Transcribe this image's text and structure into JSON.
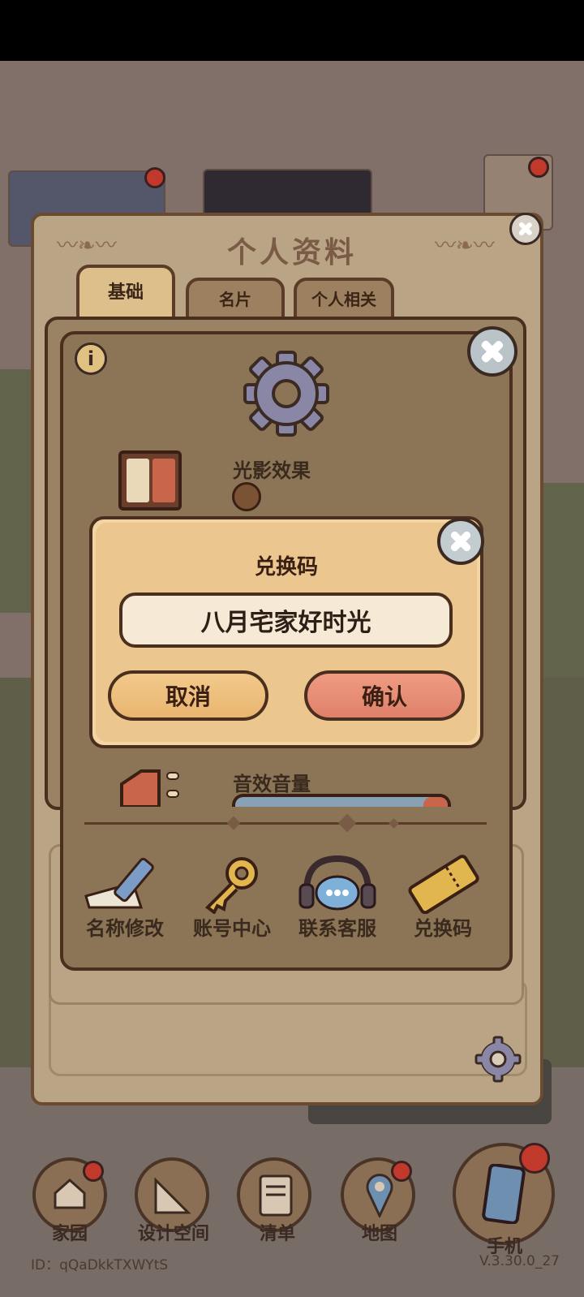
{
  "panel": {
    "title": "个人资料",
    "tabs": [
      {
        "label": "基础",
        "active": true
      },
      {
        "label": "名片",
        "active": false
      },
      {
        "label": "个人相关",
        "active": false
      }
    ]
  },
  "settings": {
    "rows": {
      "light_effect_label": "光影效果",
      "sound_volume_label": "音效音量"
    },
    "actions": [
      {
        "label": "名称修改",
        "icon": "pencil-icon"
      },
      {
        "label": "账号中心",
        "icon": "key-icon"
      },
      {
        "label": "联系客服",
        "icon": "headset-icon"
      },
      {
        "label": "兑换码",
        "icon": "ticket-icon"
      }
    ]
  },
  "redeem": {
    "title": "兑换码",
    "code_value": "八月宅家好时光",
    "cancel_label": "取消",
    "confirm_label": "确认"
  },
  "bottom_nav": [
    {
      "label": "家园",
      "badge": true
    },
    {
      "label": "设计空间",
      "badge": false
    },
    {
      "label": "清单",
      "badge": false
    },
    {
      "label": "地图",
      "badge": true
    },
    {
      "label": "手机",
      "badge": true
    }
  ],
  "footer": {
    "user_id": "ID：qQaDkkTXWYtS",
    "version": "V.3.30.0_27"
  },
  "colors": {
    "panel_bg": "#b9a485",
    "dialog_bg": "#8c7556",
    "popup_bg": "#f3d4a3",
    "cancel_button": "#ebb874",
    "confirm_button": "#e48a72",
    "badge_red": "#c0392b"
  }
}
